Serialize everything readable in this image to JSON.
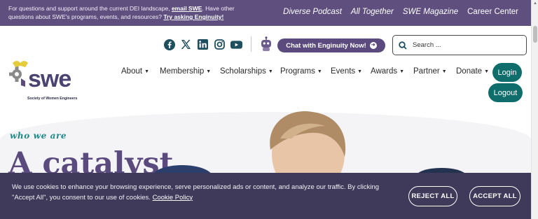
{
  "topbar": {
    "notice_line1": "For questions and support around the current DEI landscape, ",
    "email_link": "email SWE",
    "notice_line2": ". Have other questions about SWE's programs, events, and resources? ",
    "ask_link": "Try asking Enginuity!",
    "links": [
      "Diverse Podcast",
      "All Together",
      "SWE Magazine",
      "Career Center"
    ]
  },
  "socials": [
    "facebook-icon",
    "x-icon",
    "linkedin-icon",
    "instagram-icon",
    "youtube-icon"
  ],
  "chat_button": "Chat with Enginuity Now!",
  "search": {
    "placeholder": "Search ..."
  },
  "logo": {
    "wordmark": "swe",
    "tagline": "Society of Women Engineers"
  },
  "nav": [
    {
      "label": "About",
      "width": 55
    },
    {
      "label": "Membership",
      "width": 86
    },
    {
      "label": "Scholarships",
      "width": 86
    },
    {
      "label": "Programs",
      "width": 72
    },
    {
      "label": "Events",
      "width": 57
    },
    {
      "label": "Awards",
      "width": 61
    },
    {
      "label": "Partner",
      "width": 61
    },
    {
      "label": "Donate",
      "width": 55
    }
  ],
  "auth": {
    "login": "Login",
    "logout": "Logout"
  },
  "hero": {
    "eyebrow": "who we are",
    "headline": "A catalyst"
  },
  "cookie": {
    "text": "We use cookies to enhance your browsing experience, serve personalized ads or content, and analyze our traffic. By clicking \"Accept All\", you consent to our use of cookies. ",
    "policy_link": "Cookie Policy",
    "reject": "REJECT ALL",
    "accept": "ACCEPT ALL"
  },
  "colors": {
    "brand_purple": "#5e4f7e",
    "teal": "#0f6d6c",
    "banner": "#3f3a59"
  }
}
